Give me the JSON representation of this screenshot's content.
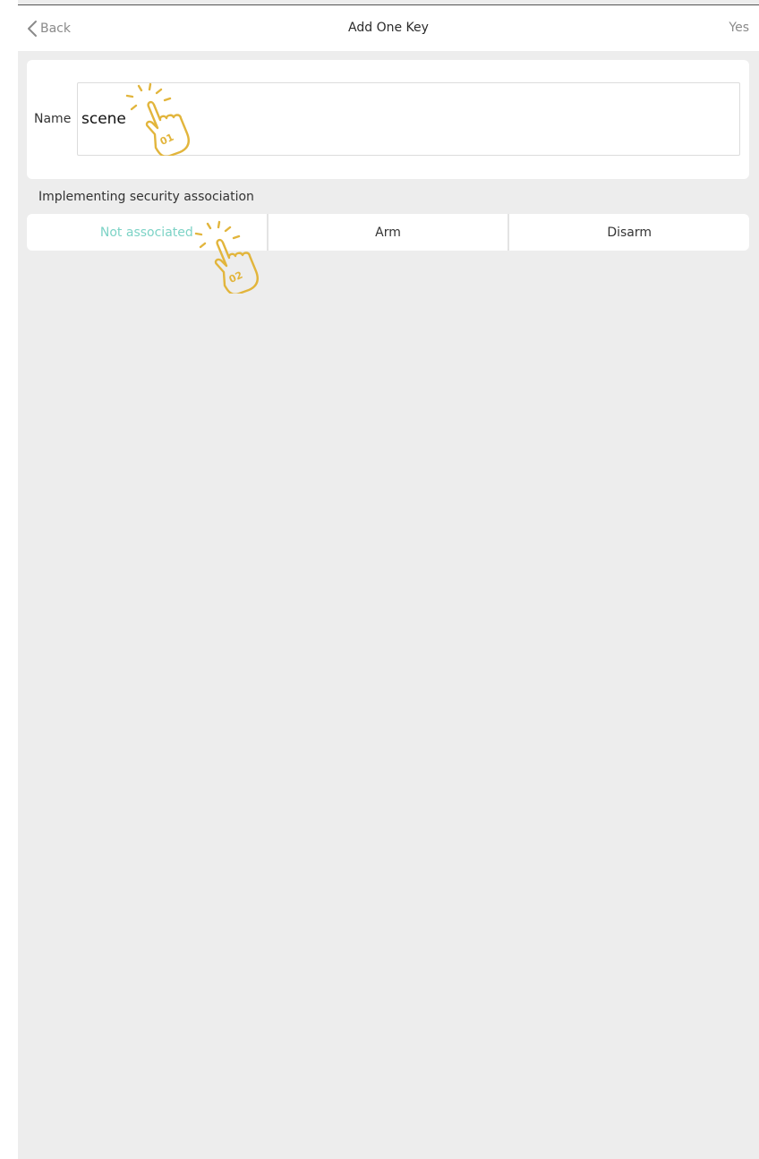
{
  "header": {
    "back_label": "Back",
    "title": "Add One Key",
    "confirm_label": "Yes"
  },
  "name_field": {
    "label": "Name",
    "value": "scene"
  },
  "association": {
    "section_label": "Implementing security association",
    "options": [
      {
        "label": "Not associated",
        "selected": true
      },
      {
        "label": "Arm",
        "selected": false
      },
      {
        "label": "Disarm",
        "selected": false
      }
    ]
  },
  "annotations": {
    "step_1": "01",
    "step_2": "02"
  },
  "colors": {
    "accent": "#7dd3c6",
    "background": "#ededed",
    "pointer": "#e2b53c"
  },
  "icons": {
    "back": "chevron-left-icon",
    "pointer": "tapping-hand-icon"
  }
}
